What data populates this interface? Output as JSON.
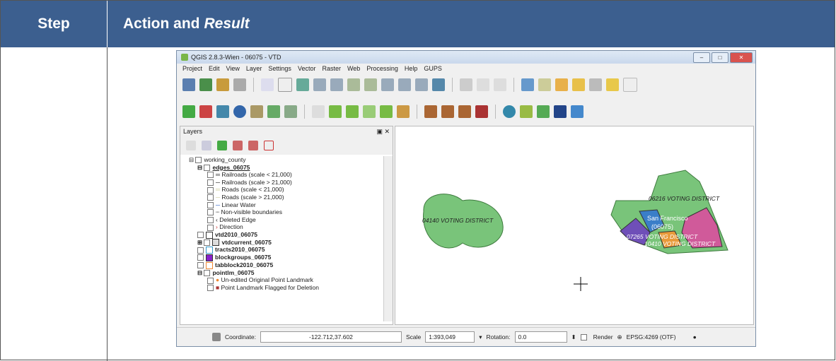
{
  "header": {
    "step": "Step",
    "action": "Action and",
    "result": "Result"
  },
  "qgis": {
    "title": "QGIS 2.8.3-Wien - 06075 - VTD",
    "menu": [
      "Project",
      "Edit",
      "View",
      "Layer",
      "Settings",
      "Vector",
      "Raster",
      "Web",
      "Processing",
      "Help",
      "GUPS"
    ],
    "panel_title": "Layers",
    "layers": [
      {
        "label": "working_county",
        "level": 0,
        "bold": false
      },
      {
        "label": "edges_06075",
        "level": 1,
        "bold": true
      },
      {
        "label": "Railroads (scale < 21,000)",
        "level": 2,
        "bold": false
      },
      {
        "label": "Railroads (scale > 21,000)",
        "level": 2,
        "bold": false
      },
      {
        "label": "Roads (scale < 21,000)",
        "level": 2,
        "bold": false
      },
      {
        "label": "Roads (scale > 21,000)",
        "level": 2,
        "bold": false
      },
      {
        "label": "Linear Water",
        "level": 2,
        "bold": false
      },
      {
        "label": "Non-visible boundaries",
        "level": 2,
        "bold": false
      },
      {
        "label": "Deleted Edge",
        "level": 2,
        "bold": false
      },
      {
        "label": "Direction",
        "level": 2,
        "bold": false
      },
      {
        "label": "vtd2010_06075",
        "level": 1,
        "bold": true
      },
      {
        "label": "vtdcurrent_06075",
        "level": 1,
        "bold": true
      },
      {
        "label": "tracts2010_06075",
        "level": 1,
        "bold": true
      },
      {
        "label": "blockgroups_06075",
        "level": 1,
        "bold": true
      },
      {
        "label": "tabblock2010_06075",
        "level": 1,
        "bold": true
      },
      {
        "label": "pointlm_06075",
        "level": 1,
        "bold": true
      },
      {
        "label": "Un-edited Original Point Landmark",
        "level": 2,
        "bold": false
      },
      {
        "label": "Point Landmark Flagged for Deletion",
        "level": 2,
        "bold": false
      }
    ],
    "map_labels": {
      "district_a": "04140 VOTING DISTRICT",
      "district_b": "06216 VOTING DISTRICT",
      "county": "San Francisco",
      "county_code": "(06075)",
      "district_c": "07265 VOTING DISTRICT",
      "district_d": "10410 VOTING DISTRICT"
    },
    "status": {
      "coord_label": "Coordinate:",
      "coord_value": "-122.712,37.602",
      "scale_label": "Scale",
      "scale_value": "1:393,049",
      "rotation_label": "Rotation:",
      "rotation_value": "0.0",
      "render_label": "Render",
      "crs": "EPSG:4269 (OTF)"
    }
  },
  "colors": {
    "header_bg": "#3c5f8f",
    "polygon_green": "#79c47a"
  }
}
